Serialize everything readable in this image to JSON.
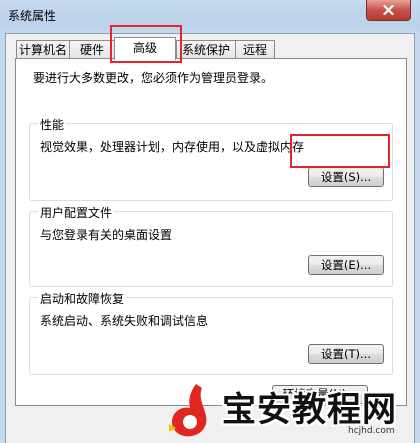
{
  "window": {
    "title": "系统属性",
    "close_symbol": "x"
  },
  "tabs": [
    {
      "label": "计算机名",
      "active": false
    },
    {
      "label": "硬件",
      "active": false
    },
    {
      "label": "高级",
      "active": true
    },
    {
      "label": "系统保护",
      "active": false
    },
    {
      "label": "远程",
      "active": false
    }
  ],
  "notice": "要进行大多数更改，您必须作为管理员登录。",
  "groups": {
    "performance": {
      "title": "性能",
      "desc": "视觉效果，处理器计划，内存使用，以及虚拟内存",
      "button": "设置(S)..."
    },
    "user_profile": {
      "title": "用户配置文件",
      "desc": "与您登录有关的桌面设置",
      "button": "设置(E)..."
    },
    "startup_recovery": {
      "title": "启动和故障恢复",
      "desc": "系统启动、系统失败和调试信息",
      "button": "设置(T)..."
    }
  },
  "env_button": "环境变量(N)...",
  "watermark": {
    "text": "宝安教程网",
    "url": "hcjhd.com"
  },
  "colors": {
    "highlight_red": "#e8232b",
    "logo_red": "#e0261f"
  }
}
